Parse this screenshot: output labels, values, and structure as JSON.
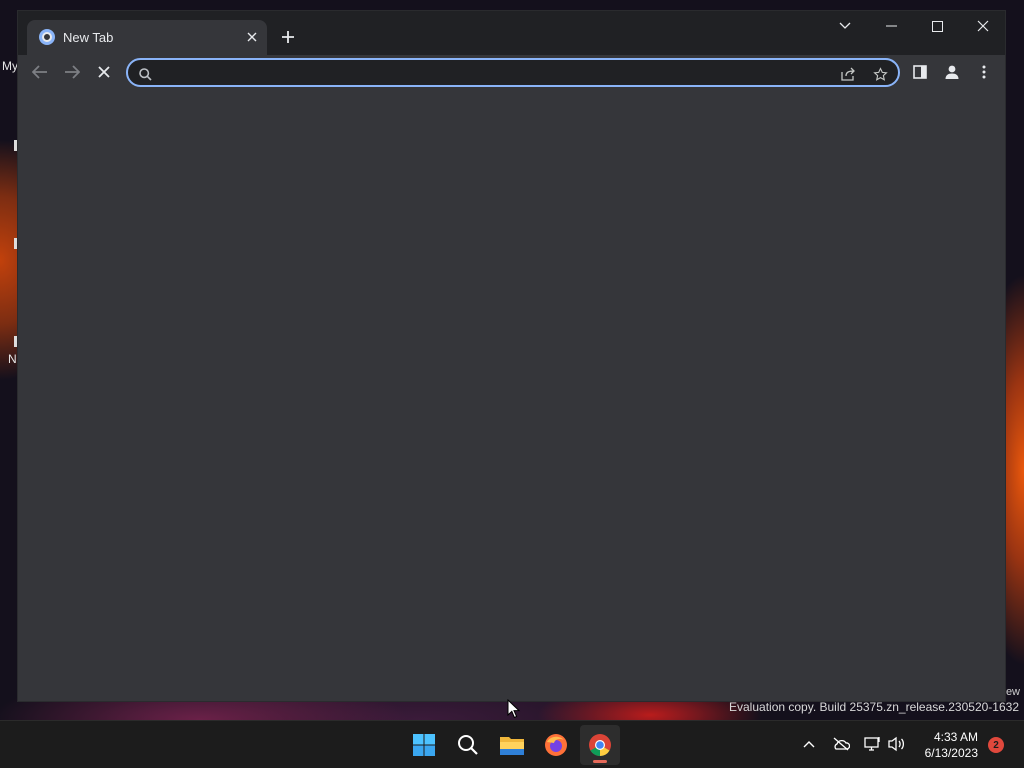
{
  "browser": {
    "tab": {
      "title": "New Tab"
    },
    "omnibox": {
      "value": "",
      "placeholder": ""
    },
    "icons": {
      "tab_favicon": "chrome-newtab-icon",
      "tab_close": "close-icon",
      "new_tab": "plus-icon",
      "tab_search": "chevron-down-icon",
      "minimize": "minimize-icon",
      "maximize": "maximize-icon",
      "close_window": "close-icon",
      "back": "arrow-left-icon",
      "forward": "arrow-right-icon",
      "stop": "stop-icon",
      "search": "search-icon",
      "share": "share-icon",
      "bookmark": "star-icon",
      "side_panel": "side-panel-icon",
      "profile": "profile-icon",
      "menu": "kebab-menu-icon"
    },
    "theme": {
      "frame": "#202124",
      "toolbar": "#35363a",
      "focus_ring": "#8ab4f8"
    }
  },
  "desktop": {
    "fragments": [
      "My",
      "N"
    ],
    "watermark": "Evaluation copy. Build 25375.zn_release.230520-1632",
    "watermark_tail": "ew"
  },
  "taskbar": {
    "apps": [
      "windows-start-icon",
      "search-icon",
      "file-explorer-icon",
      "firefox-icon",
      "chrome-icon"
    ],
    "active_app": "chrome-icon",
    "tray": [
      "chevron-up-icon",
      "onedrive-offline-icon",
      "network-icon",
      "volume-icon"
    ],
    "time": "4:33 AM",
    "date": "6/13/2023",
    "notification_count": "2"
  }
}
